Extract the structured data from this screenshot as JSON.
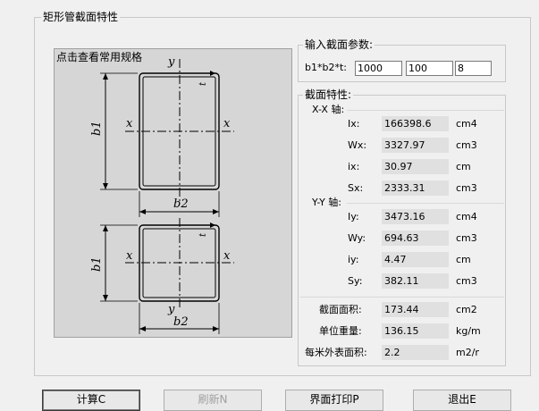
{
  "outer_group": {
    "title": "矩形管截面特性"
  },
  "preview": {
    "title": "点击查看常用规格"
  },
  "input_group": {
    "title": "输入截面参数:",
    "label": "b1*b2*t:",
    "b1": "1000",
    "b2": "100",
    "t": "8"
  },
  "props_group": {
    "title": "截面特性:",
    "xx_title": "X-X 轴:",
    "yy_title": "Y-Y 轴:",
    "xx": [
      {
        "label": "Ix:",
        "value": "166398.6",
        "unit": "cm4"
      },
      {
        "label": "Wx:",
        "value": "3327.97",
        "unit": "cm3"
      },
      {
        "label": "ix:",
        "value": "30.97",
        "unit": "cm"
      },
      {
        "label": "Sx:",
        "value": "2333.31",
        "unit": "cm3"
      }
    ],
    "yy": [
      {
        "label": "Iy:",
        "value": "3473.16",
        "unit": "cm4"
      },
      {
        "label": "Wy:",
        "value": "694.63",
        "unit": "cm3"
      },
      {
        "label": "iy:",
        "value": "4.47",
        "unit": "cm"
      },
      {
        "label": "Sy:",
        "value": "382.11",
        "unit": "cm3"
      }
    ],
    "area": {
      "label": "截面面积:",
      "value": "173.44",
      "unit": "cm2"
    },
    "weight": {
      "label": "单位重量:",
      "value": "136.15",
      "unit": "kg/m"
    },
    "surface": {
      "label": "每米外表面积:",
      "value": "2.2",
      "unit": "m2/m"
    }
  },
  "diagram": {
    "y": "y",
    "x": "x",
    "t": "t",
    "b1": "b1",
    "b2": "b2"
  },
  "buttons": {
    "calc": "计算C",
    "refresh": "刷新N",
    "print": "界面打印P",
    "exit": "退出E"
  }
}
